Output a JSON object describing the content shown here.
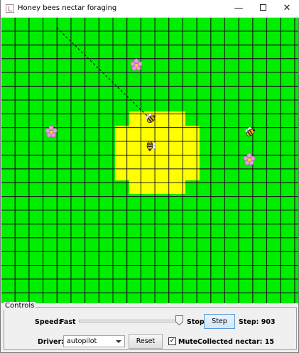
{
  "window": {
    "title": "Honey bees nectar foraging",
    "min_glyph": "—",
    "close_glyph": "✕"
  },
  "field": {
    "colors": {
      "grass": "#00ee00",
      "hive": "#ffff00",
      "grid": "#1a1a1a"
    },
    "icons": [
      "flower-icon",
      "bee-icon"
    ]
  },
  "controls": {
    "title": "Controls",
    "speed_label": "Speed:",
    "speed_min_label": "Fast",
    "speed_max_label": "Stop",
    "speed_level": 0.93,
    "step_button": "Step",
    "step_label": "Step: 903",
    "driver_label": "Driver:",
    "driver_value": "autopilot",
    "reset_button": "Reset",
    "mute_checked": true,
    "mute_label": "Mute",
    "nectar_label": "Collected nectar: 15"
  }
}
